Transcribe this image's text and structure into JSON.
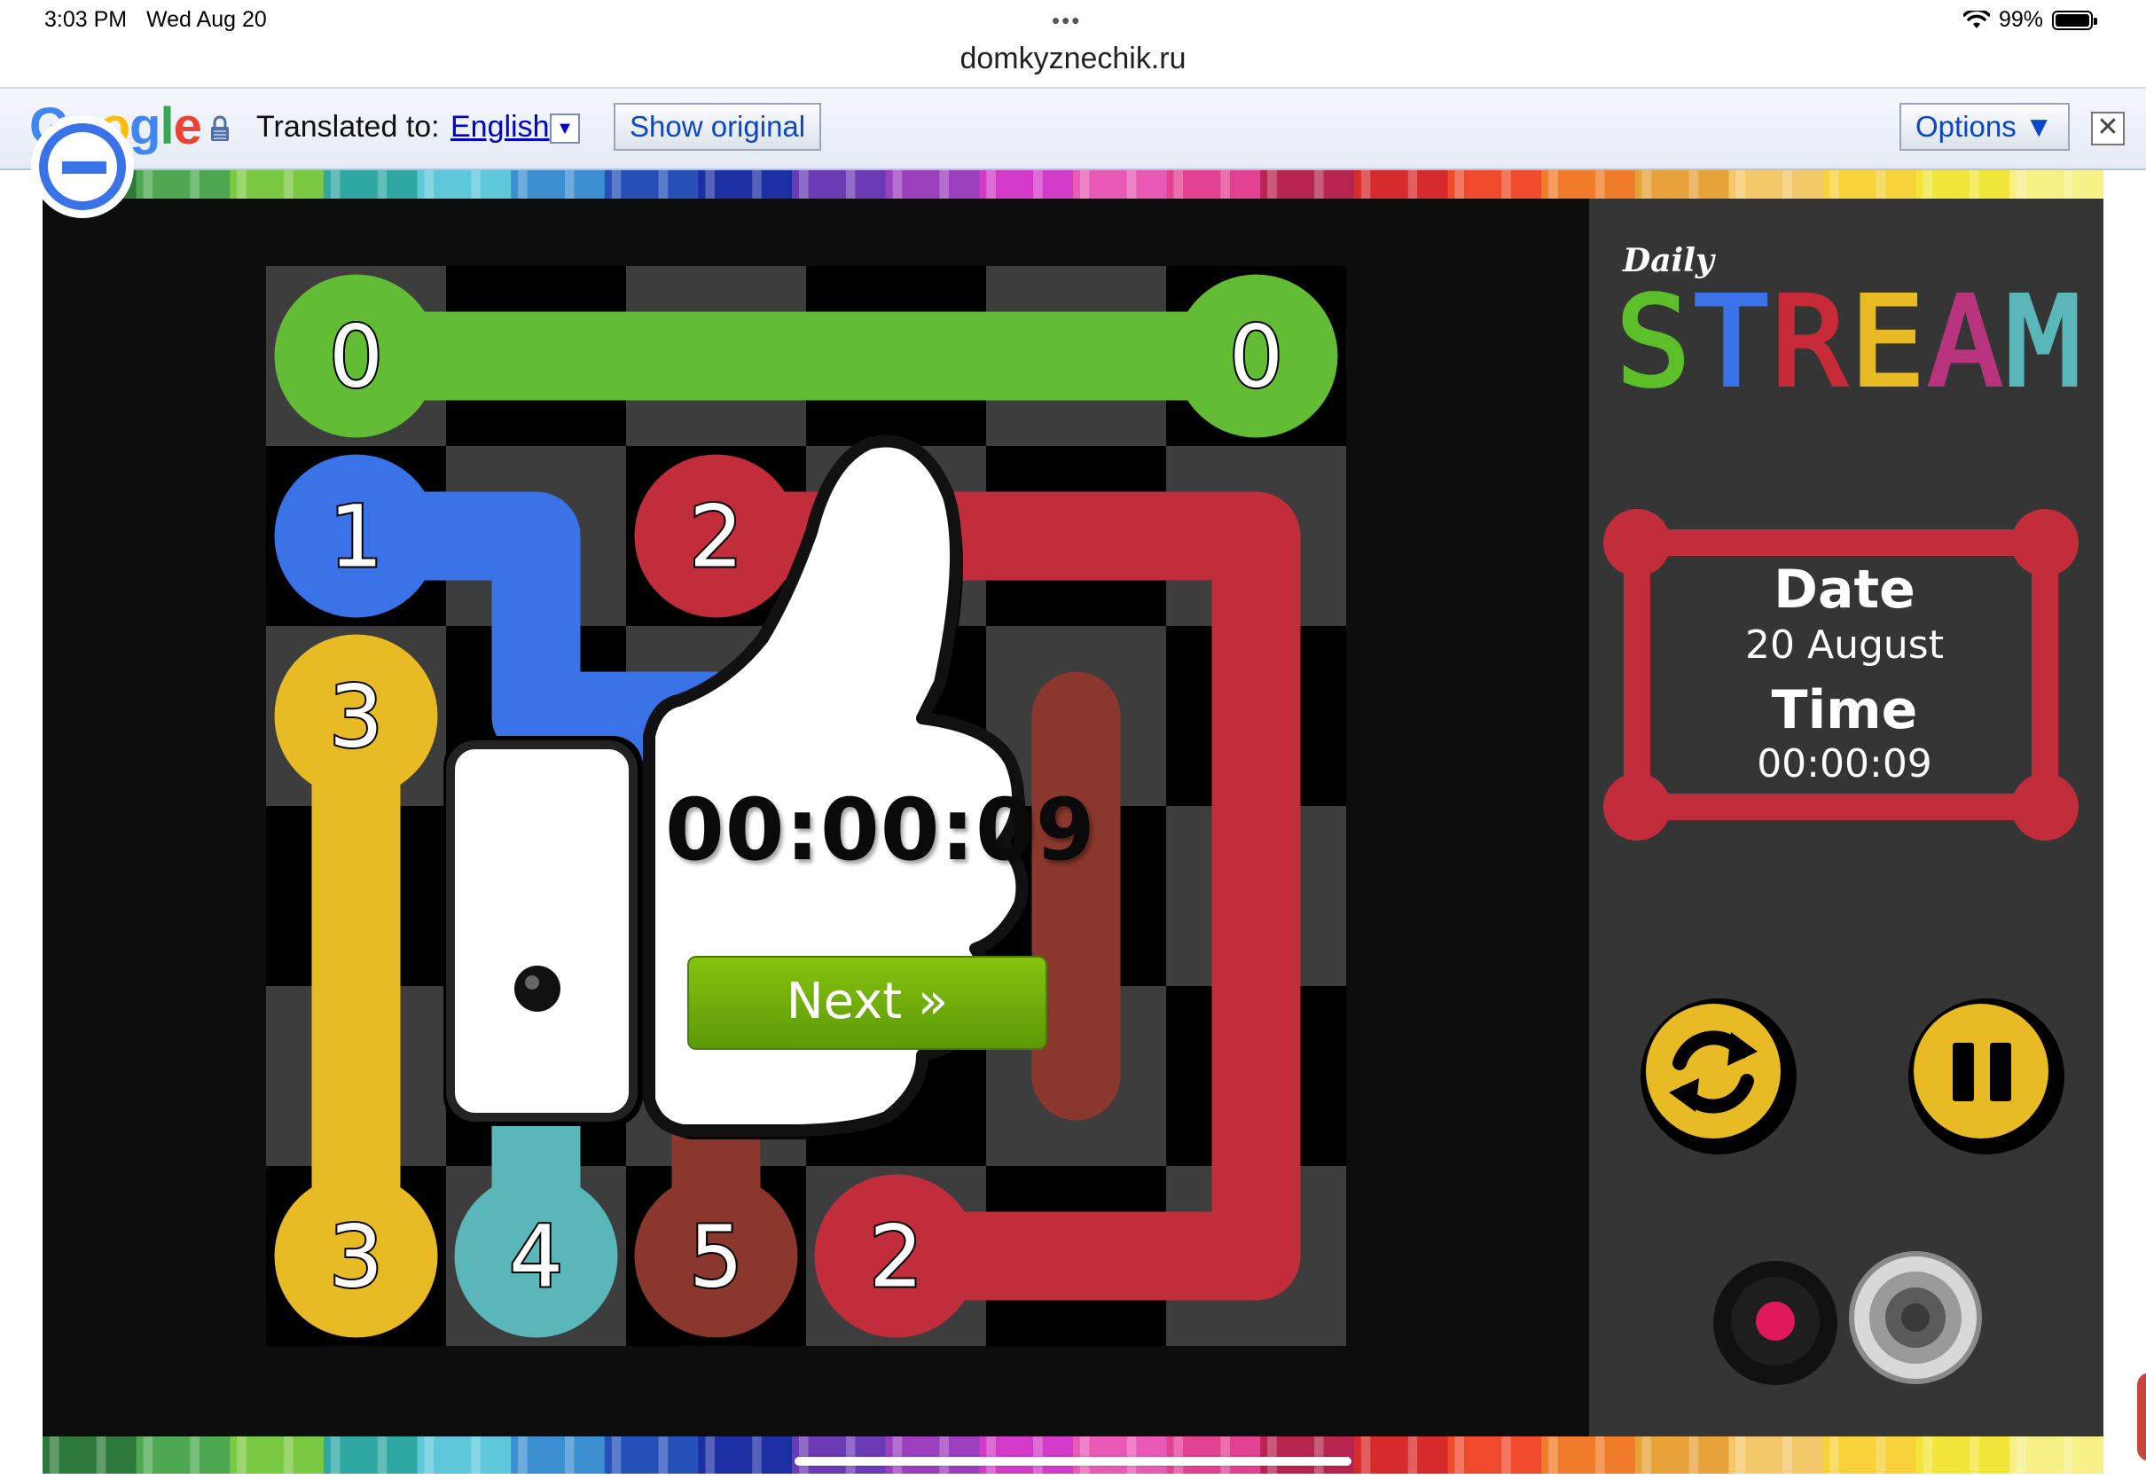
{
  "status_bar": {
    "time": "3:03 PM",
    "date": "Wed Aug 20",
    "battery": "99%",
    "battery_level": 0.99,
    "dots": "•••"
  },
  "browser": {
    "url": "domkyznechik.ru"
  },
  "translate_bar": {
    "logo": [
      "G",
      "o",
      "o",
      "g",
      "l",
      "e"
    ],
    "logo_colors": [
      "#4285f4",
      "#ea4335",
      "#fbbc05",
      "#4285f4",
      "#34a853",
      "#ea4335"
    ],
    "translated_to_label": "Translated to:",
    "language": "English",
    "dropdown_arrow": "▼",
    "show_original": "Show original",
    "options": "Options ▼",
    "close": "✕"
  },
  "game": {
    "logo_small": "Daily",
    "logo_big": [
      "S",
      "T",
      "R",
      "E",
      "A",
      "M"
    ],
    "logo_colors": [
      "#5cbf2a",
      "#3a73e8",
      "#c62b37",
      "#e8bb25",
      "#b9347e",
      "#5ab7b9"
    ],
    "info": {
      "date_label": "Date",
      "date_value": "20 August",
      "time_label": "Time",
      "time_value": "00:00:09"
    },
    "popup": {
      "time": "00:00:09",
      "next_button": "Next »"
    },
    "board": {
      "rows": 6,
      "cols": 6,
      "endpoints": [
        {
          "label": "0",
          "row": 0,
          "col": 0,
          "color": "#62bd35"
        },
        {
          "label": "0",
          "row": 0,
          "col": 5,
          "color": "#62bd35"
        },
        {
          "label": "1",
          "row": 1,
          "col": 0,
          "color": "#3a73e8"
        },
        {
          "label": "2",
          "row": 1,
          "col": 2,
          "color": "#c12d3a"
        },
        {
          "label": "3",
          "row": 2,
          "col": 0,
          "color": "#e8bb25"
        },
        {
          "label": "3",
          "row": 5,
          "col": 0,
          "color": "#e8bb25"
        },
        {
          "label": "4",
          "row": 5,
          "col": 1,
          "color": "#5ab7b9"
        },
        {
          "label": "5",
          "row": 5,
          "col": 2,
          "color": "#8a372d"
        },
        {
          "label": "2",
          "row": 5,
          "col": 3,
          "color": "#c12d3a"
        }
      ]
    },
    "controls": {
      "restart": "refresh-icon",
      "pause": "pause-icon",
      "record": "record-icon",
      "sound": "speaker-icon"
    }
  },
  "colors": {
    "board_dark": "#000000",
    "board_light": "#3d3d3d",
    "frame_bg": "#0d0d0d",
    "sidebar_bg": "#353535",
    "accent_red": "#c12d3a",
    "button_yellow": "#e8bb25",
    "next_green": "#6aa90b"
  }
}
